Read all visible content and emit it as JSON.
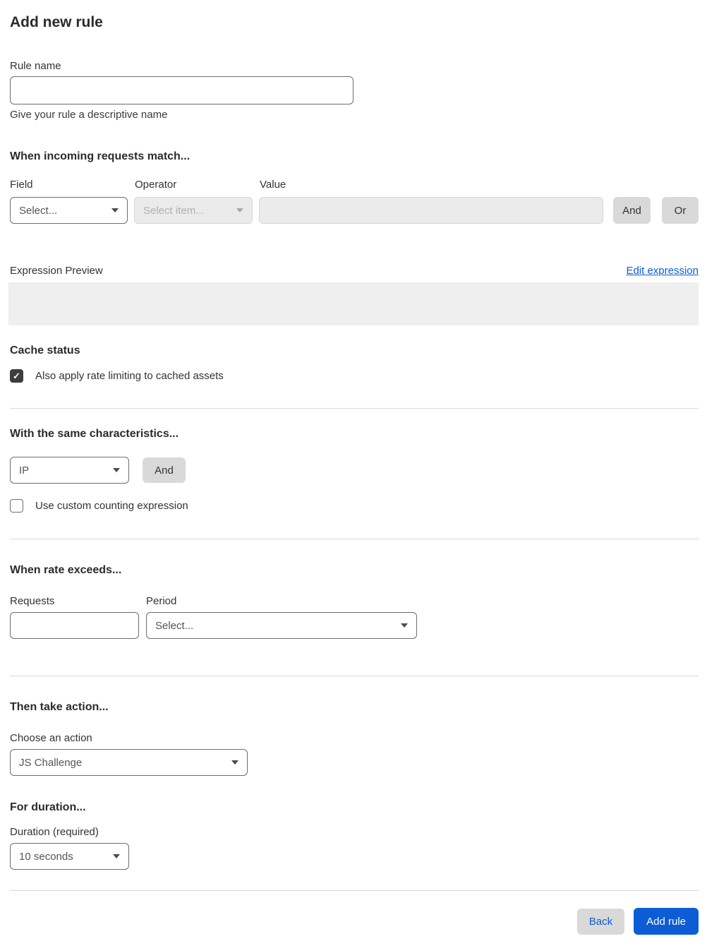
{
  "title": "Add new rule",
  "rule_name": {
    "label": "Rule name",
    "value": "",
    "helper": "Give your rule a descriptive name"
  },
  "match": {
    "heading": "When incoming requests match...",
    "field_label": "Field",
    "field_value": "Select...",
    "operator_label": "Operator",
    "operator_value": "Select item...",
    "value_label": "Value",
    "value_text": "",
    "and_label": "And",
    "or_label": "Or"
  },
  "expression": {
    "preview_label": "Expression Preview",
    "edit_link": "Edit expression",
    "content": ""
  },
  "cache": {
    "heading": "Cache status",
    "checkbox_label": "Also apply rate limiting to cached assets",
    "checked": true,
    "check_glyph": "✓"
  },
  "characteristics": {
    "heading": "With the same characteristics...",
    "select_value": "IP",
    "and_label": "And",
    "checkbox_label": "Use custom counting expression",
    "checked": false
  },
  "rate": {
    "heading": "When rate exceeds...",
    "requests_label": "Requests",
    "requests_value": "",
    "period_label": "Period",
    "period_value": "Select..."
  },
  "action": {
    "heading": "Then take action...",
    "choose_label": "Choose an action",
    "value": "JS Challenge"
  },
  "duration": {
    "heading": "For duration...",
    "label": "Duration (required)",
    "value": "10 seconds"
  },
  "footer": {
    "back_label": "Back",
    "add_rule_label": "Add rule"
  },
  "colors": {
    "accent_blue": "#0b5cd5",
    "button_gray": "#d9d9d9",
    "disabled_bg": "#ebebeb",
    "border_dark": "#6e6e6e",
    "border_light": "#d9d9d9",
    "checkbox_fill": "#3d3d3d",
    "text_dark": "#333333",
    "placeholder_gray": "#595959",
    "disabled_text": "#b0b0b0"
  }
}
